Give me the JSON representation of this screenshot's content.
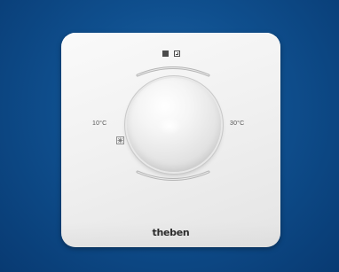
{
  "device": {
    "temp_min_label": "10°C",
    "temp_max_label": "30°C",
    "brand": "theben",
    "mode_icons": [
      "filled-square-icon",
      "plus-square-icon"
    ],
    "frost_icon": "snowflake-icon"
  },
  "colors": {
    "background": "#0f4f8e",
    "plate": "#f1f1f1",
    "text": "#2b2b2b"
  }
}
